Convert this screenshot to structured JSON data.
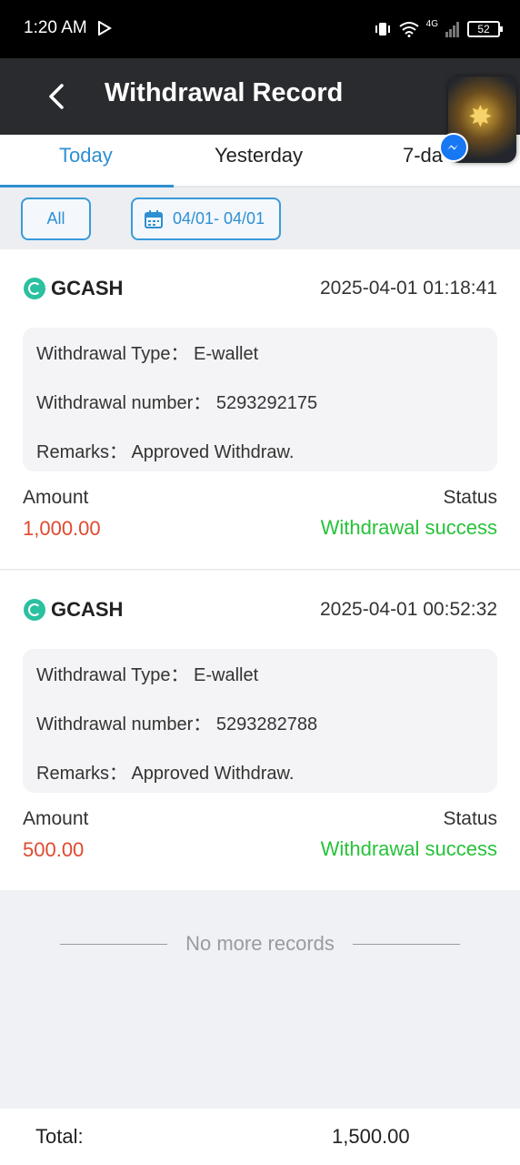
{
  "status_bar": {
    "time": "1:20 AM",
    "network": "4G",
    "battery": "52"
  },
  "header": {
    "title": "Withdrawal Record"
  },
  "tabs": [
    {
      "label": "Today",
      "active": true
    },
    {
      "label": "Yesterday",
      "active": false
    },
    {
      "label": "7-da",
      "active": false
    }
  ],
  "filters": {
    "all_label": "All",
    "date_range": "04/01- 04/01"
  },
  "records": [
    {
      "method": "GCASH",
      "datetime": "2025-04-01 01:18:41",
      "type_label": "Withdrawal Type：",
      "type_value": "E-wallet",
      "number_label": "Withdrawal number：",
      "number_value": "5293292175",
      "remarks_label": "Remarks：",
      "remarks_value": "Approved Withdraw.",
      "amount_label": "Amount",
      "amount_value": "1,000.00",
      "status_label": "Status",
      "status_value": "Withdrawal success"
    },
    {
      "method": "GCASH",
      "datetime": "2025-04-01 00:52:32",
      "type_label": "Withdrawal Type：",
      "type_value": "E-wallet",
      "number_label": "Withdrawal number：",
      "number_value": "5293282788",
      "remarks_label": "Remarks：",
      "remarks_value": "Approved Withdraw.",
      "amount_label": "Amount",
      "amount_value": "500.00",
      "status_label": "Status",
      "status_value": "Withdrawal success"
    }
  ],
  "no_more": "No more records",
  "footer": {
    "total_label": "Total:",
    "total_value": "1,500.00"
  },
  "colors": {
    "accent": "#2e8fd3",
    "amount": "#e0492e",
    "success": "#27c23a",
    "header_bg": "#2a2b2e"
  },
  "icons": {
    "back": "back-arrow-icon",
    "calendar": "calendar-icon",
    "method": "gcash-icon",
    "floating": "messenger-icon"
  }
}
